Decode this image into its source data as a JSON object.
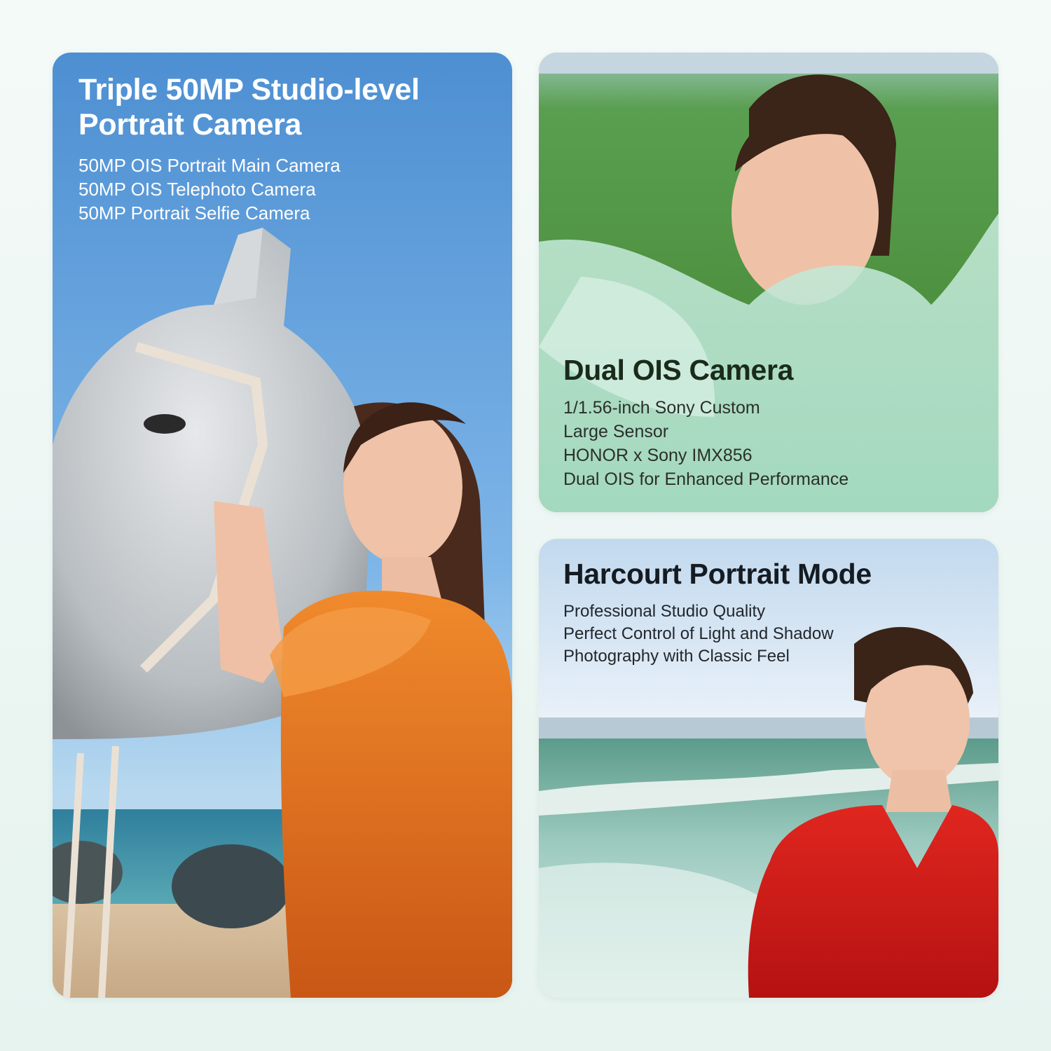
{
  "cards": [
    {
      "title": "Triple 50MP Studio-level Portrait Camera",
      "lines": [
        "50MP OIS Portrait Main Camera",
        "50MP OIS Telephoto Camera",
        "50MP Portrait Selfie Camera"
      ]
    },
    {
      "title": "Dual OIS Camera",
      "lines": [
        "1/1.56-inch Sony Custom",
        "Large Sensor",
        "HONOR x Sony IMX856",
        "Dual OIS for Enhanced Performance"
      ]
    },
    {
      "title": "Harcourt Portrait Mode",
      "lines": [
        "Professional Studio Quality",
        "Perfect Control of Light and Shadow",
        "Photography with Classic Feel"
      ]
    }
  ],
  "colors": {
    "page_bg": "#eef7f4",
    "sky_blue": "#5a98d6",
    "grass_green": "#4f9a45",
    "dress_orange": "#d7681d",
    "dress_red": "#d21a1a",
    "tulle_mint": "#a8dcc6"
  }
}
